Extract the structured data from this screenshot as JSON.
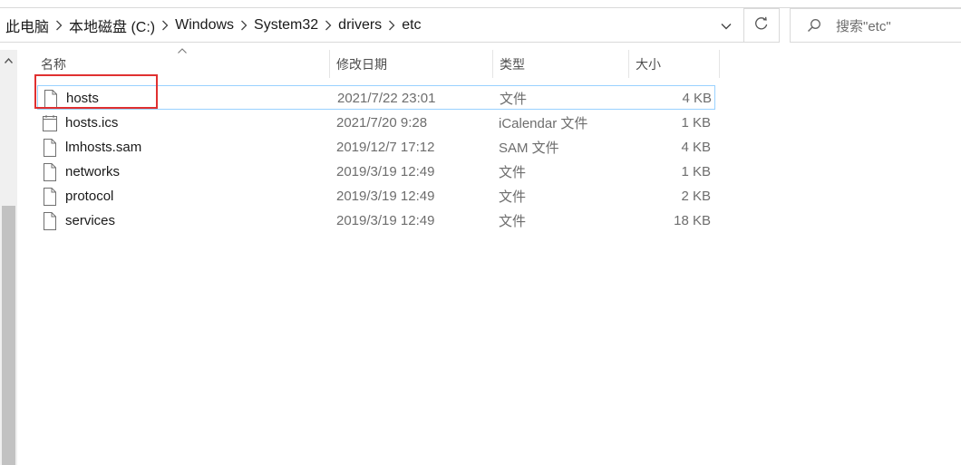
{
  "address": {
    "breadcrumbs": [
      "此电脑",
      "本地磁盘 (C:)",
      "Windows",
      "System32",
      "drivers",
      "etc"
    ]
  },
  "search": {
    "placeholder": "搜索\"etc\""
  },
  "columns": {
    "name": "名称",
    "date": "修改日期",
    "type": "类型",
    "size": "大小"
  },
  "files": [
    {
      "name": "hosts",
      "date": "2021/7/22 23:01",
      "type": "文件",
      "size": "4 KB",
      "icon": "blank-file-icon"
    },
    {
      "name": "hosts.ics",
      "date": "2021/7/20 9:28",
      "type": "iCalendar 文件",
      "size": "1 KB",
      "icon": "calendar-file-icon"
    },
    {
      "name": "lmhosts.sam",
      "date": "2019/12/7 17:12",
      "type": "SAM 文件",
      "size": "4 KB",
      "icon": "blank-file-icon"
    },
    {
      "name": "networks",
      "date": "2019/3/19 12:49",
      "type": "文件",
      "size": "1 KB",
      "icon": "blank-file-icon"
    },
    {
      "name": "protocol",
      "date": "2019/3/19 12:49",
      "type": "文件",
      "size": "2 KB",
      "icon": "blank-file-icon"
    },
    {
      "name": "services",
      "date": "2019/3/19 12:49",
      "type": "文件",
      "size": "18 KB",
      "icon": "blank-file-icon"
    }
  ],
  "colors": {
    "selection_border": "#99d1ff",
    "highlight": "#e03030"
  }
}
